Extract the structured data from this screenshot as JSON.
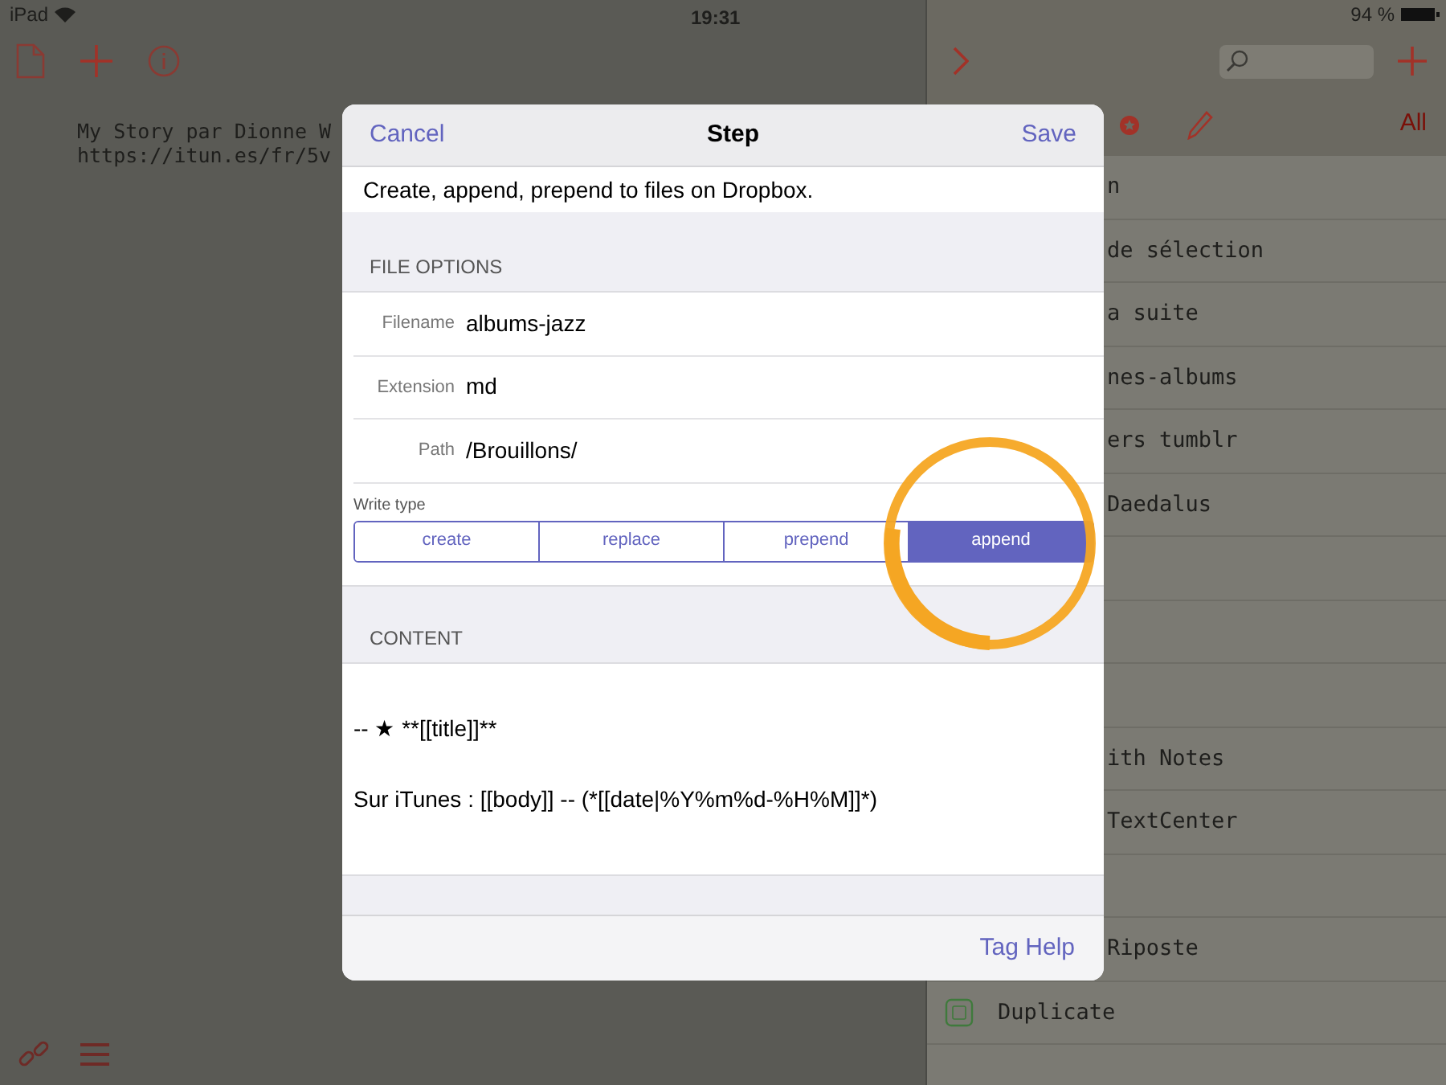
{
  "status_bar": {
    "device": "iPad",
    "time": "19:31",
    "battery": "94 %"
  },
  "editor": {
    "lines": [
      "My Story par Dionne W",
      "https://itun.es/fr/5v"
    ]
  },
  "list_toolbar": {
    "filter": "All"
  },
  "list": {
    "rows": [
      {
        "kind": "text",
        "label": "n"
      },
      {
        "kind": "text",
        "label": "de sélection"
      },
      {
        "kind": "text",
        "label": "a suite"
      },
      {
        "kind": "text",
        "label": "nes-albums"
      },
      {
        "kind": "text",
        "label": "ers tumblr"
      },
      {
        "kind": "text",
        "label": "Daedalus"
      },
      {
        "kind": "empty"
      },
      {
        "kind": "empty"
      },
      {
        "kind": "empty"
      },
      {
        "kind": "text",
        "label": "ith Notes"
      },
      {
        "kind": "text",
        "label": "TextCenter"
      },
      {
        "kind": "empty"
      },
      {
        "kind": "text",
        "label": "Riposte"
      },
      {
        "kind": "icon",
        "label": "Duplicate"
      }
    ]
  },
  "dialog": {
    "cancel": "Cancel",
    "title": "Step",
    "save": "Save",
    "description": "Create, append, prepend to files on Dropbox.",
    "file_options_header": "FILE OPTIONS",
    "fields": [
      {
        "label": "Filename",
        "value": "albums-jazz"
      },
      {
        "label": "Extension",
        "value": "md"
      },
      {
        "label": "Path",
        "value": "/Brouillons/"
      }
    ],
    "write_type_label": "Write type",
    "write_types": [
      {
        "label": "create",
        "selected": false
      },
      {
        "label": "replace",
        "selected": false
      },
      {
        "label": "prepend",
        "selected": false
      },
      {
        "label": "append",
        "selected": true
      }
    ],
    "content_header": "CONTENT",
    "content_lines": [
      "-- ★ **[[title]]**",
      "Sur iTunes : [[body]] -- (*[[date|%Y%m%d-%H%M]]*)"
    ],
    "tag_help": "Tag Help"
  }
}
